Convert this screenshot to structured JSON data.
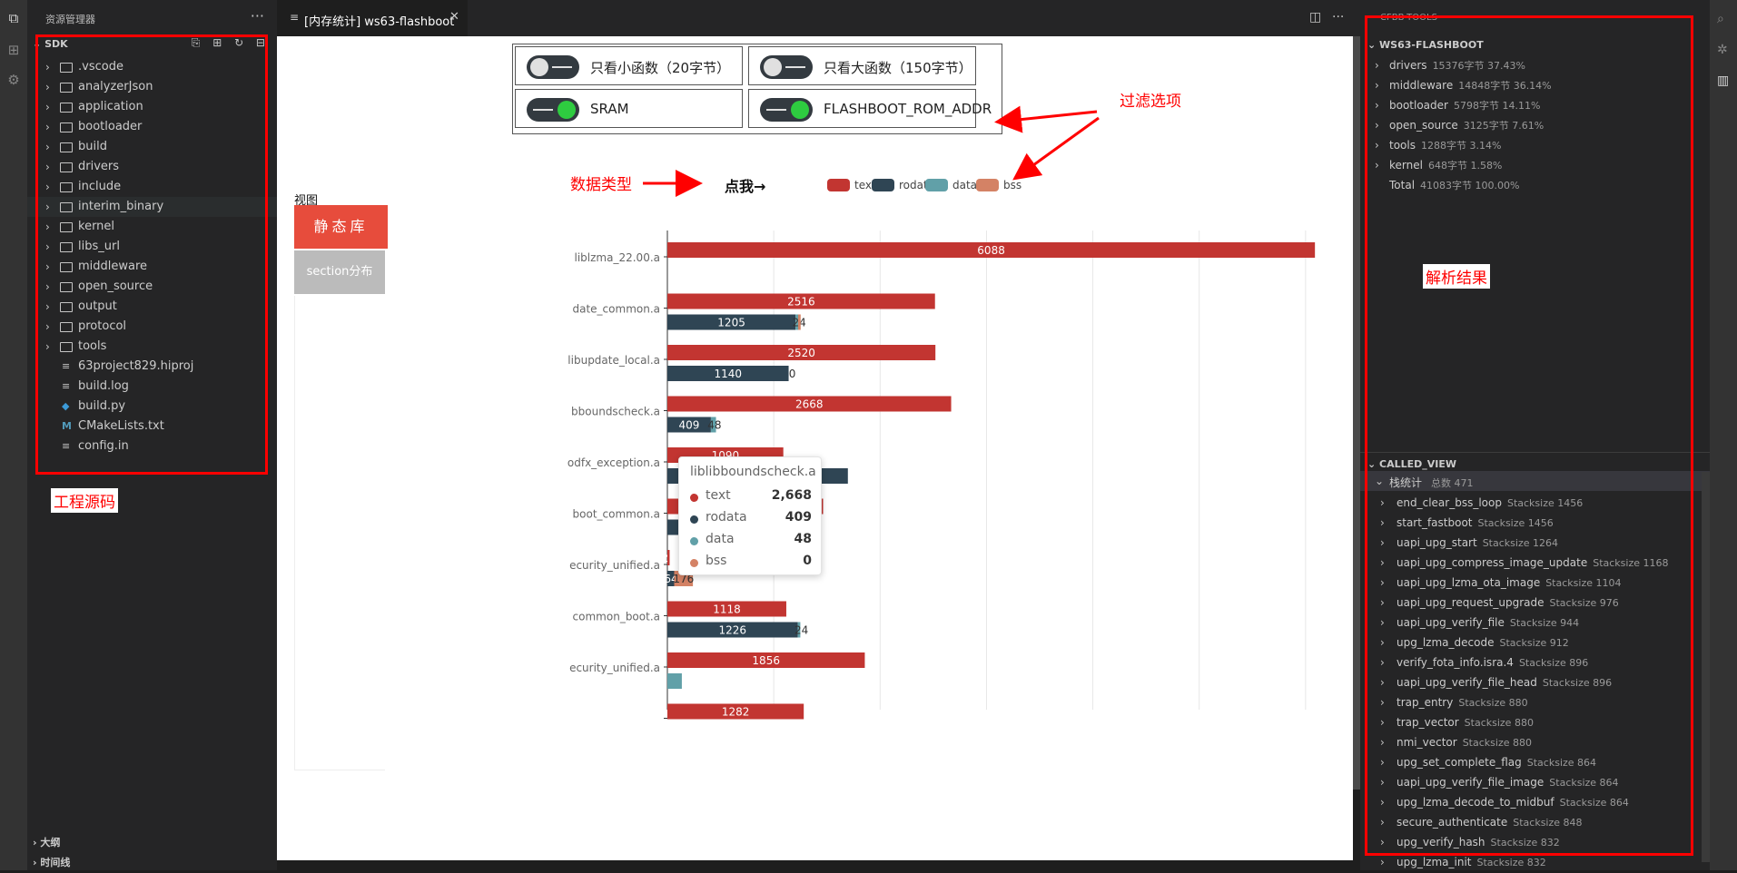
{
  "explorer": {
    "title": "资源管理器",
    "more": "···",
    "root": "SDK",
    "root_tools": "⎘ ⊞ ↻ ⊟",
    "items": [
      {
        "label": ".vscode",
        "kind": "folder"
      },
      {
        "label": "analyzerJson",
        "kind": "folder"
      },
      {
        "label": "application",
        "kind": "folder"
      },
      {
        "label": "bootloader",
        "kind": "folder"
      },
      {
        "label": "build",
        "kind": "folder"
      },
      {
        "label": "drivers",
        "kind": "folder"
      },
      {
        "label": "include",
        "kind": "folder"
      },
      {
        "label": "interim_binary",
        "kind": "folder"
      },
      {
        "label": "kernel",
        "kind": "folder"
      },
      {
        "label": "libs_url",
        "kind": "folder"
      },
      {
        "label": "middleware",
        "kind": "folder"
      },
      {
        "label": "open_source",
        "kind": "folder"
      },
      {
        "label": "output",
        "kind": "folder"
      },
      {
        "label": "protocol",
        "kind": "folder"
      },
      {
        "label": "tools",
        "kind": "folder"
      },
      {
        "label": "63project829.hiproj",
        "kind": "file"
      },
      {
        "label": "build.log",
        "kind": "file"
      },
      {
        "label": "build.py",
        "kind": "python"
      },
      {
        "label": "CMakeLists.txt",
        "kind": "cmake"
      },
      {
        "label": "config.in",
        "kind": "file"
      }
    ],
    "outline": "大纲",
    "timeline": "时间线"
  },
  "annotations": {
    "source": "工程源码",
    "filter": "过滤选项",
    "datatype": "数据类型",
    "result": "解析结果"
  },
  "tab": {
    "label": "[内存统计] ws63-flashboot",
    "close": "✕"
  },
  "filters": {
    "small": "只看小函数（20字节）",
    "large": "只看大函数（150字节）",
    "sram": "SRAM",
    "flashboot": "FLASHBOOT_ROM_ADDR",
    "small_on": false,
    "large_on": false,
    "sram_on": true,
    "flashboot_on": true
  },
  "legend": {
    "click": "点我→",
    "items": [
      {
        "name": "text",
        "color": "#c23531"
      },
      {
        "name": "rodata",
        "color": "#2f4554"
      },
      {
        "name": "data",
        "color": "#61a0a8"
      },
      {
        "name": "bss",
        "color": "#d48265"
      }
    ]
  },
  "view": {
    "label": "视图",
    "static": "静态库",
    "section": "section分布"
  },
  "chart_data": {
    "type": "bar",
    "orientation": "horizontal",
    "categories": [
      "liblzma_22.00.a",
      "date_common.a",
      "libupdate_local.a",
      "bboundscheck.a",
      "odfx_exception.a",
      "boot_common.a",
      "ecurity_unified.a",
      "common_boot.a",
      "ecurity_unified.a",
      ""
    ],
    "series": [
      {
        "name": "text",
        "values": [
          6088,
          2516,
          2520,
          2668,
          1090,
          1464,
          21,
          1118,
          1856,
          1282
        ]
      },
      {
        "name": "rodata",
        "values": [
          0,
          1205,
          1140,
          409,
          1697,
          1130,
          64,
          1226,
          0,
          null
        ]
      },
      {
        "name": "data",
        "values": [
          0,
          24,
          0,
          48,
          0,
          0,
          0,
          24,
          136,
          null
        ]
      },
      {
        "name": "bss",
        "values": [
          0,
          24,
          0,
          0,
          0,
          0,
          176,
          0,
          0,
          null
        ]
      }
    ],
    "point_labels": [
      [
        "6088",
        "0",
        "",
        ""
      ],
      [
        "2516",
        "1205",
        "24",
        ""
      ],
      [
        "2520",
        "1140",
        "0",
        ""
      ],
      [
        "2668",
        "409",
        "48",
        ""
      ],
      [
        "1090",
        "1697",
        "",
        ""
      ],
      [
        "1464",
        "1130",
        "",
        ""
      ],
      [
        "21",
        "64",
        "",
        "176"
      ],
      [
        "1118",
        "1226",
        "24",
        ""
      ],
      [
        "1856",
        "136",
        "",
        ""
      ],
      [
        "1282",
        "",
        "",
        ""
      ]
    ],
    "xlim": [
      0,
      7000
    ],
    "grid": true,
    "tooltip": {
      "title": "liblibboundscheck.a",
      "rows": [
        {
          "name": "text",
          "value": "2,668",
          "color": "#c23531"
        },
        {
          "name": "rodata",
          "value": "409",
          "color": "#2f4554"
        },
        {
          "name": "data",
          "value": "48",
          "color": "#61a0a8"
        },
        {
          "name": "bss",
          "value": "0",
          "color": "#d48265"
        }
      ]
    }
  },
  "right": {
    "top": "CFBB-TOOLS",
    "section1": "WS63-FLASHBOOT",
    "items": [
      {
        "name": "drivers",
        "meta": "15376字节  37.43%",
        "chev": true
      },
      {
        "name": "middleware",
        "meta": "14848字节  36.14%",
        "chev": true
      },
      {
        "name": "bootloader",
        "meta": "5798字节  14.11%",
        "chev": true
      },
      {
        "name": "open_source",
        "meta": "3125字节  7.61%",
        "chev": true
      },
      {
        "name": "tools",
        "meta": "1288字节  3.14%",
        "chev": true
      },
      {
        "name": "kernel",
        "meta": "648字节  1.58%",
        "chev": true
      },
      {
        "name": "Total",
        "meta": "41083字节  100.00%",
        "chev": false
      }
    ],
    "section2": "CALLED_VIEW",
    "stack_title": "栈统计",
    "stack_total": "总数 471",
    "calls": [
      {
        "name": "end_clear_bss_loop",
        "meta": "Stacksize 1456"
      },
      {
        "name": "start_fastboot",
        "meta": "Stacksize 1456"
      },
      {
        "name": "uapi_upg_start",
        "meta": "Stacksize 1264"
      },
      {
        "name": "uapi_upg_compress_image_update",
        "meta": "Stacksize 1168"
      },
      {
        "name": "uapi_upg_lzma_ota_image",
        "meta": "Stacksize 1104"
      },
      {
        "name": "uapi_upg_request_upgrade",
        "meta": "Stacksize 976"
      },
      {
        "name": "uapi_upg_verify_file",
        "meta": "Stacksize 944"
      },
      {
        "name": "upg_lzma_decode",
        "meta": "Stacksize 912"
      },
      {
        "name": "verify_fota_info.isra.4",
        "meta": "Stacksize 896"
      },
      {
        "name": "uapi_upg_verify_file_head",
        "meta": "Stacksize 896"
      },
      {
        "name": "trap_entry",
        "meta": "Stacksize 880"
      },
      {
        "name": "trap_vector",
        "meta": "Stacksize 880"
      },
      {
        "name": "nmi_vector",
        "meta": "Stacksize 880"
      },
      {
        "name": "upg_set_complete_flag",
        "meta": "Stacksize 864"
      },
      {
        "name": "uapi_upg_verify_file_image",
        "meta": "Stacksize 864"
      },
      {
        "name": "upg_lzma_decode_to_midbuf",
        "meta": "Stacksize 864"
      },
      {
        "name": "secure_authenticate",
        "meta": "Stacksize 848"
      },
      {
        "name": "upg_verify_hash",
        "meta": "Stacksize 832"
      },
      {
        "name": "upg_lzma_init",
        "meta": "Stacksize 832"
      }
    ]
  }
}
